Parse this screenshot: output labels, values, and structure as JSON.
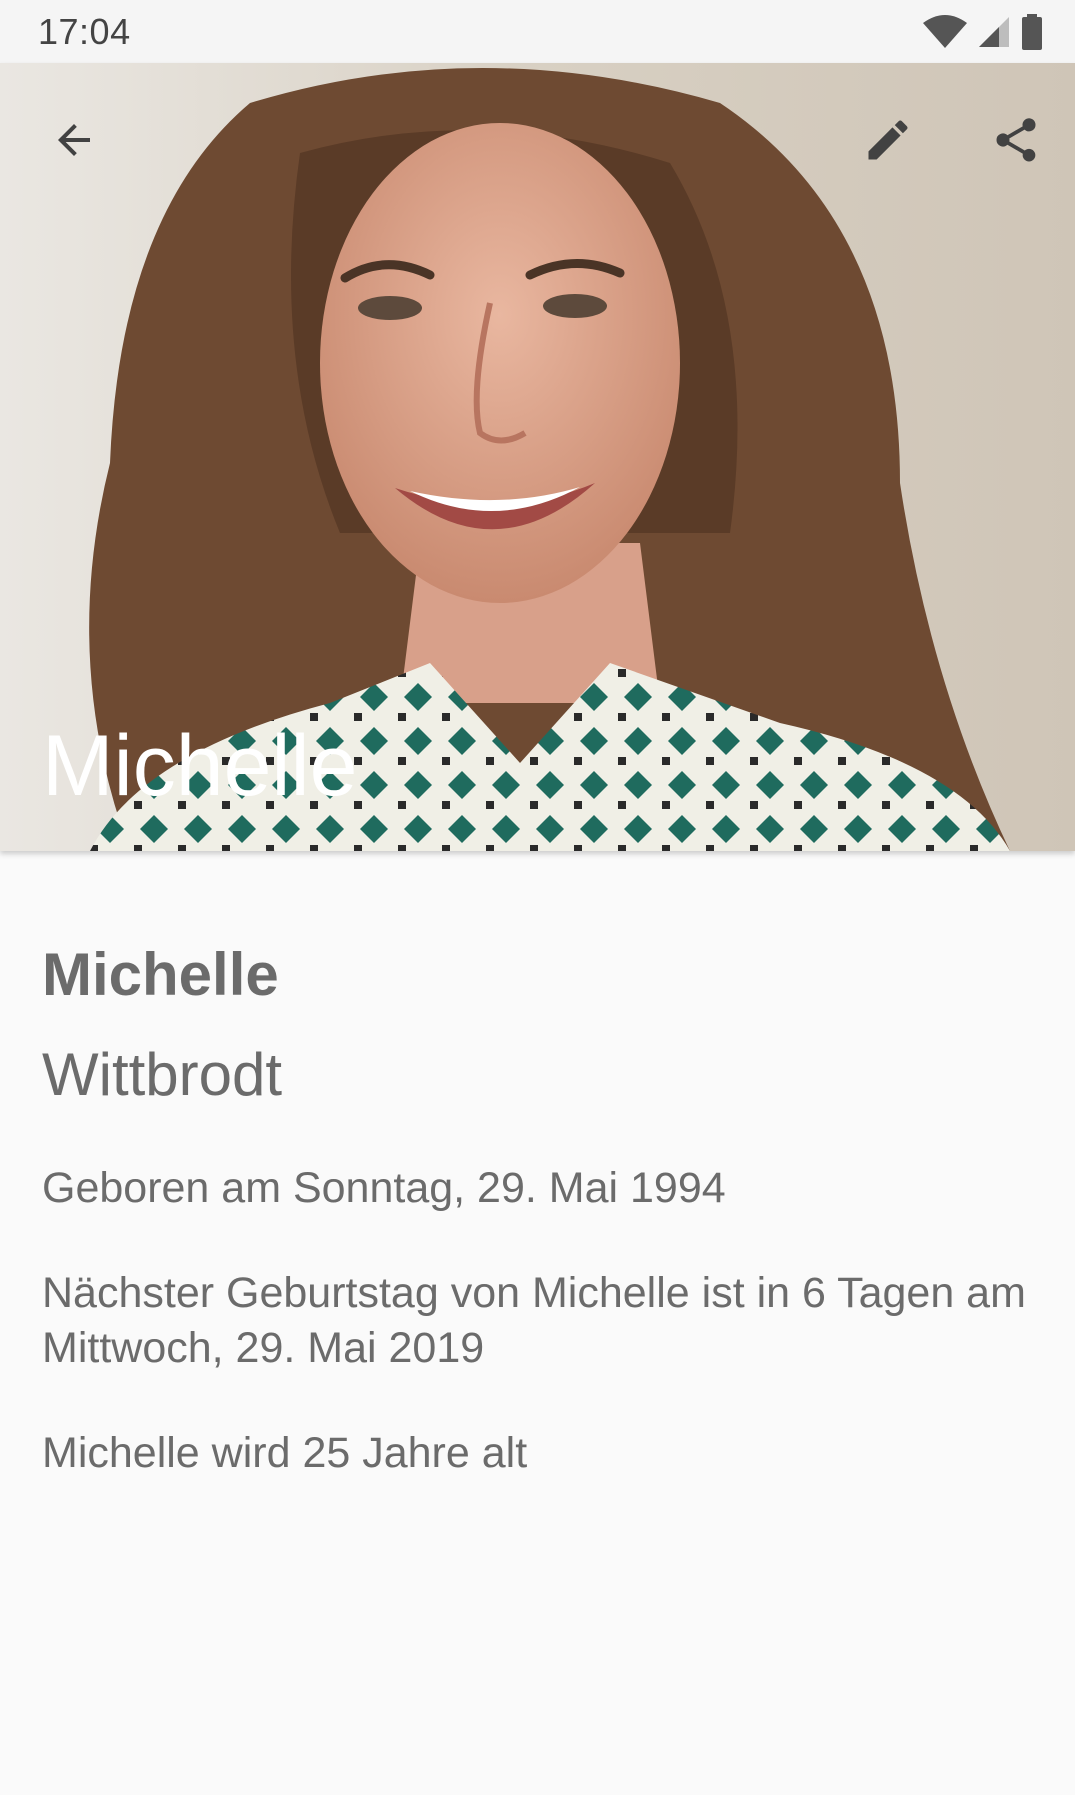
{
  "status_bar": {
    "time": "17:04",
    "icons": [
      "wifi-icon",
      "cell-signal-icon",
      "battery-icon"
    ]
  },
  "toolbar": {
    "back_icon": "arrow-back-icon",
    "edit_icon": "pencil-edit-icon",
    "share_icon": "share-icon"
  },
  "header": {
    "title": "Michelle"
  },
  "person": {
    "first_name": "Michelle",
    "last_name": "Wittbrodt",
    "born": "Geboren am Sonntag, 29. Mai 1994",
    "next_birthday": "Nächster Geburtstag von Michelle ist in 6 Tagen am Mittwoch, 29. Mai 2019",
    "age": "Michelle wird 25 Jahre alt"
  },
  "colors": {
    "background": "#fafafa",
    "text": "#6b6b6b",
    "toolbar_icons": "#424242",
    "title_overlay": "#ffffff"
  }
}
